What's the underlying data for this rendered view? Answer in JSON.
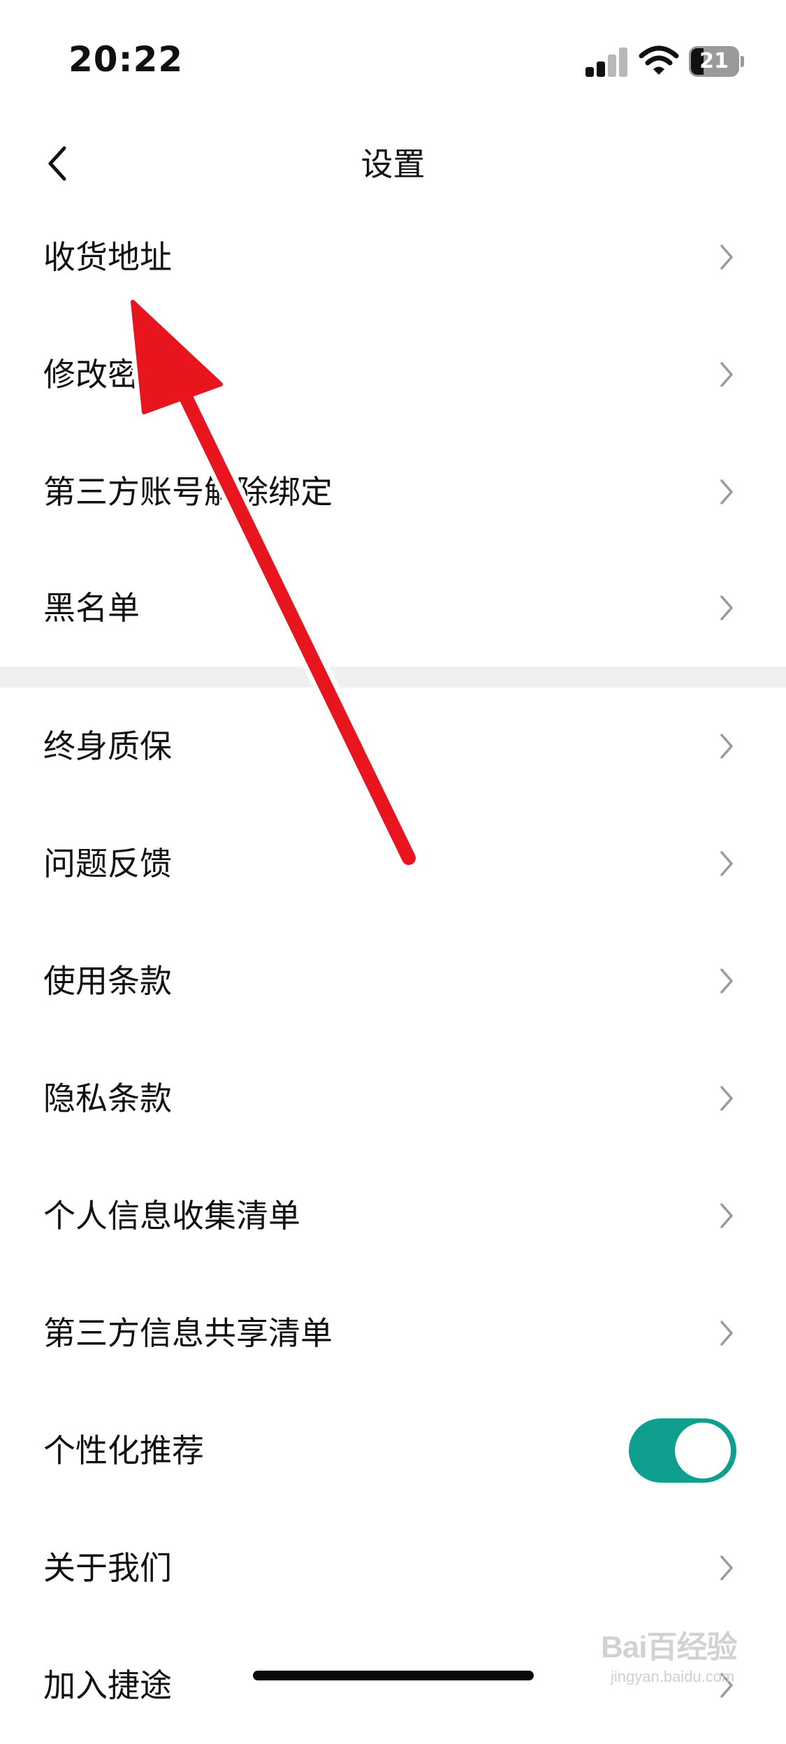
{
  "status_bar": {
    "time": "20:22",
    "battery_level": "21",
    "icons": [
      "signal-icon",
      "wifi-icon",
      "battery-icon"
    ]
  },
  "nav": {
    "title": "设置",
    "back_icon": "chevron-left-icon"
  },
  "menu": {
    "items": [
      {
        "label": "收货地址"
      },
      {
        "label": "修改密码"
      },
      {
        "label": "第三方账号解除绑定"
      },
      {
        "label": "黑名单"
      },
      {
        "label": "终身质保"
      },
      {
        "label": "问题反馈"
      },
      {
        "label": "使用条款"
      },
      {
        "label": "隐私条款"
      },
      {
        "label": "个人信息收集清单"
      },
      {
        "label": "第三方信息共享清单"
      },
      {
        "label": "个性化推荐",
        "toggle_on": true
      },
      {
        "label": "关于我们"
      },
      {
        "label": "加入捷途"
      }
    ]
  },
  "colors": {
    "toggle_on": "#0f9f8e",
    "annotation_arrow": "#e8141e",
    "section_divider": "#eff1f1"
  },
  "watermark": {
    "main": "Bai百经验",
    "sub": "jingyan.baidu.com"
  }
}
